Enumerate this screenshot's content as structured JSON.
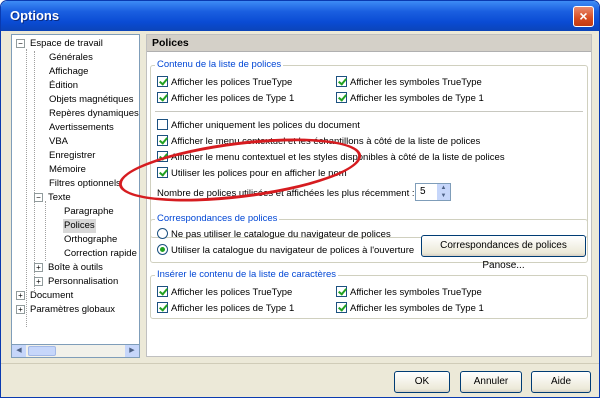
{
  "window": {
    "title": "Options",
    "close_glyph": "×"
  },
  "tree": {
    "items": [
      {
        "label": "Espace de travail",
        "toggle": "−"
      },
      {
        "label": "Générales"
      },
      {
        "label": "Affichage"
      },
      {
        "label": "Édition"
      },
      {
        "label": "Objets magnétiques"
      },
      {
        "label": "Repères dynamiques"
      },
      {
        "label": "Avertissements"
      },
      {
        "label": "VBA"
      },
      {
        "label": "Enregistrer"
      },
      {
        "label": "Mémoire"
      },
      {
        "label": "Filtres optionnels"
      },
      {
        "label": "Texte",
        "toggle": "−"
      },
      {
        "label": "Paragraphe"
      },
      {
        "label": "Polices",
        "selected": true
      },
      {
        "label": "Orthographe"
      },
      {
        "label": "Correction rapide"
      },
      {
        "label": "Boîte à outils",
        "toggle": "+"
      },
      {
        "label": "Personnalisation",
        "toggle": "+"
      },
      {
        "label": "Document",
        "toggle": "+"
      },
      {
        "label": "Paramètres globaux",
        "toggle": "+"
      }
    ]
  },
  "panel": {
    "heading": "Polices",
    "content_group": {
      "title": "Contenu de la liste de polices",
      "checkboxes": [
        {
          "label": "Afficher les polices TrueType",
          "checked": true
        },
        {
          "label": "Afficher les symboles TrueType",
          "checked": true
        },
        {
          "label": "Afficher les polices de Type 1",
          "checked": true
        },
        {
          "label": "Afficher les symboles de Type 1",
          "checked": true
        },
        {
          "label": "Afficher uniquement les polices du document",
          "checked": false
        },
        {
          "label": "Afficher le menu contextuel et les échantillons à côté de la liste de polices",
          "checked": true
        },
        {
          "label": "Afficher le menu contextuel et les styles disponibles à côté de la liste de polices",
          "checked": true
        },
        {
          "label": "Utiliser les polices pour en afficher le nom",
          "checked": true
        }
      ],
      "recent_label": "Nombre de polices utilisées et affichées les plus récemment :",
      "recent_value": "5"
    },
    "mapping_group": {
      "title": "Correspondances de polices",
      "radios": [
        {
          "label": "Ne pas utiliser le catalogue du navigateur de polices",
          "selected": false
        },
        {
          "label": "Utiliser la catalogue du navigateur de polices à l'ouverture",
          "selected": true
        }
      ],
      "panose_button": "Correspondances de polices Panose..."
    },
    "charlist_group": {
      "title": "Insérer le contenu de la liste de caractères",
      "checkboxes": [
        {
          "label": "Afficher les polices TrueType",
          "checked": true
        },
        {
          "label": "Afficher les symboles TrueType",
          "checked": true
        },
        {
          "label": "Afficher les polices de Type 1",
          "checked": true
        },
        {
          "label": "Afficher les symboles de Type 1",
          "checked": true
        }
      ]
    }
  },
  "buttons": {
    "ok": "OK",
    "cancel": "Annuler",
    "help": "Aide"
  },
  "colors": {
    "titlebar": "#0a4bd4",
    "group_title": "#0046d5",
    "check": "#21a121",
    "highlight_ellipse": "#d61c20"
  }
}
